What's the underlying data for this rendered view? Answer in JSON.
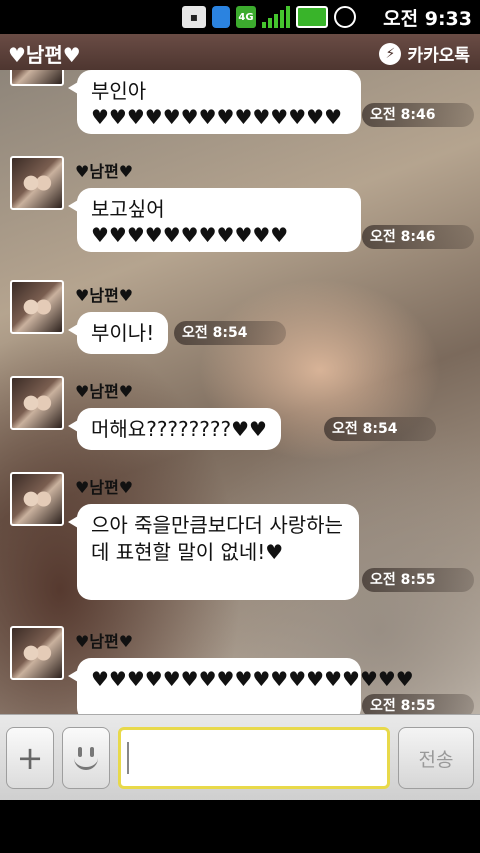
{
  "status_bar": {
    "time": "오전 9:33",
    "network": "4G"
  },
  "header": {
    "title": "♥남편♥",
    "app_name": "카카오톡"
  },
  "messages": [
    {
      "sender": "",
      "text": "부인아♥♥♥♥♥♥♥♥♥♥♥♥♥♥",
      "time": "오전 8:46"
    },
    {
      "sender": "♥남편♥",
      "text": "보고싶어♥♥♥♥♥♥♥♥♥♥♥",
      "time": "오전 8:46"
    },
    {
      "sender": "♥남편♥",
      "text": "부이나!",
      "time": "오전 8:54"
    },
    {
      "sender": "♥남편♥",
      "text": "머해요????????♥♥",
      "time": "오전 8:54"
    },
    {
      "sender": "♥남편♥",
      "text": "으아 죽을만큼보다더 사랑하는데 표현할 말이 없네!♥",
      "time": "오전 8:55"
    },
    {
      "sender": "♥남편♥",
      "text": "♥♥♥♥♥♥♥♥♥♥♥♥♥♥♥♥♥♥",
      "time": "오전 8:55"
    }
  ],
  "input": {
    "placeholder": "",
    "send_label": "전송",
    "plus_label": "+"
  }
}
